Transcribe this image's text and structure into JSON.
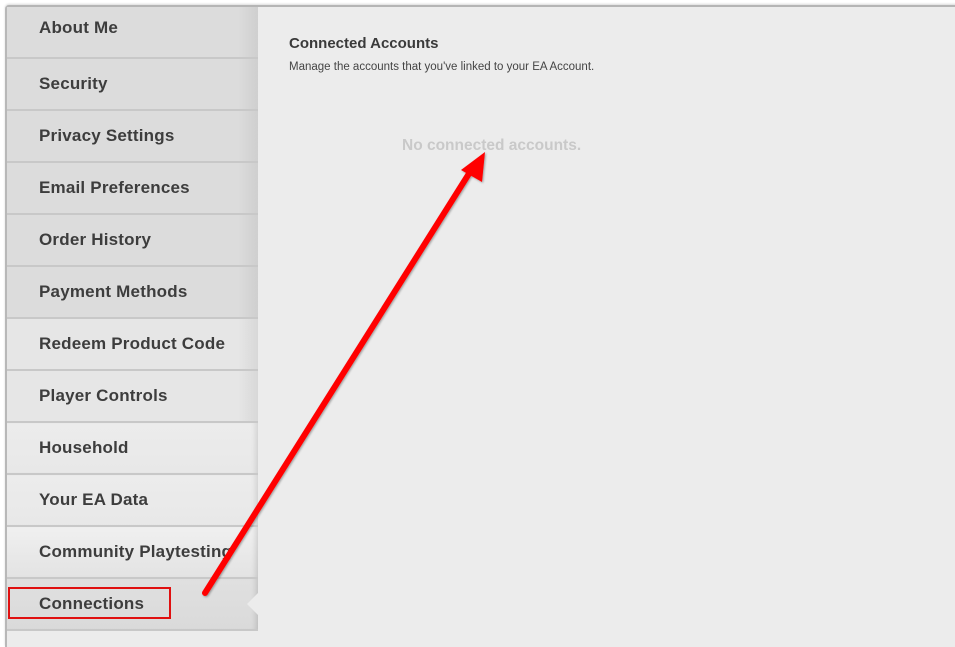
{
  "sidebar": {
    "items": [
      {
        "label": "About Me"
      },
      {
        "label": "Security"
      },
      {
        "label": "Privacy Settings"
      },
      {
        "label": "Email Preferences"
      },
      {
        "label": "Order History"
      },
      {
        "label": "Payment Methods"
      },
      {
        "label": "Redeem Product Code"
      },
      {
        "label": "Player Controls"
      },
      {
        "label": "Household"
      },
      {
        "label": "Your EA Data"
      },
      {
        "label": "Community Playtesting"
      },
      {
        "label": "Connections"
      }
    ],
    "active_item": "Connections"
  },
  "main": {
    "title": "Connected Accounts",
    "description": "Manage the accounts that you've linked to your EA Account.",
    "empty_state": "No connected accounts."
  },
  "annotation": {
    "highlight_color": "#e01010",
    "arrow_color": "#ff0000",
    "arrow_from": "Connections",
    "arrow_to": "No connected accounts."
  }
}
